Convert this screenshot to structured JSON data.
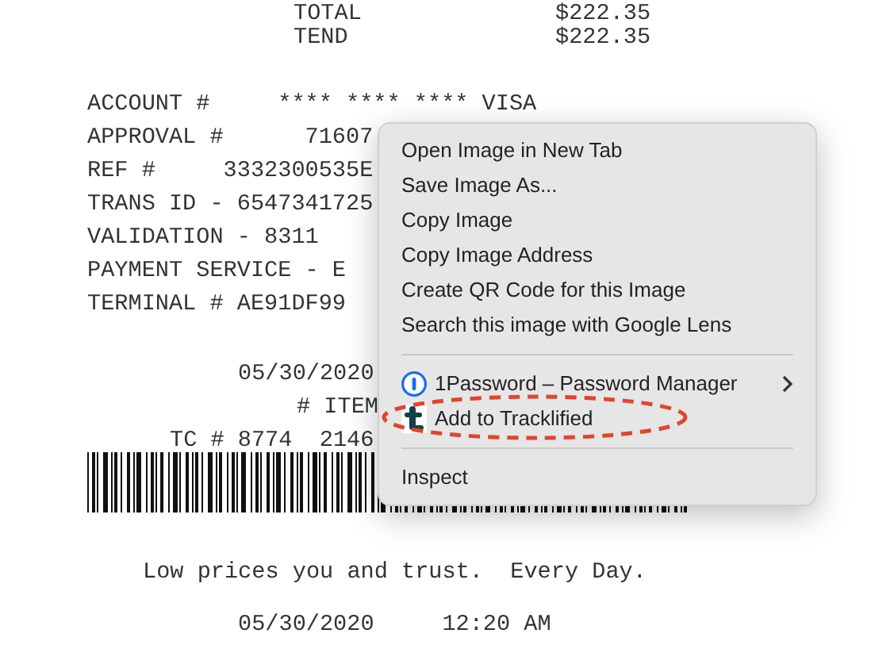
{
  "receipt": {
    "lines": [
      {
        "text": "TOTAL"
      },
      {
        "text": "$222.35"
      },
      {
        "text": "TEND"
      },
      {
        "text": "$222.35"
      },
      {
        "text": "ACCOUNT #     **** **** **** VISA"
      },
      {
        "text": "APPROVAL #      71607"
      },
      {
        "text": "REF #     3332300535E"
      },
      {
        "text": "TRANS ID - 6547341725"
      },
      {
        "text": "VALIDATION - 8311"
      },
      {
        "text": "PAYMENT SERVICE - E"
      },
      {
        "text": "TERMINAL # AE91DF99"
      },
      {
        "text": "05/30/2020"
      },
      {
        "text": "# ITEM"
      },
      {
        "text": "TC # 8774  2146"
      },
      {
        "text": "Low prices you and trust.  Every Day."
      },
      {
        "text": "05/30/2020     12:20 AM"
      }
    ]
  },
  "context_menu": {
    "items": [
      {
        "kind": "item",
        "label": "Open Image in New Tab"
      },
      {
        "kind": "item",
        "label": "Save Image As..."
      },
      {
        "kind": "item",
        "label": "Copy Image"
      },
      {
        "kind": "item",
        "label": "Copy Image Address"
      },
      {
        "kind": "item",
        "label": "Create QR Code for this Image"
      },
      {
        "kind": "item",
        "label": "Search this image with Google Lens"
      },
      {
        "kind": "separator"
      },
      {
        "kind": "submenu",
        "label": "1Password – Password Manager",
        "highlighted": false
      },
      {
        "kind": "extension",
        "label": "Add to Tracklified",
        "highlighted": true
      },
      {
        "kind": "separator"
      },
      {
        "kind": "item",
        "label": "Inspect"
      }
    ]
  }
}
